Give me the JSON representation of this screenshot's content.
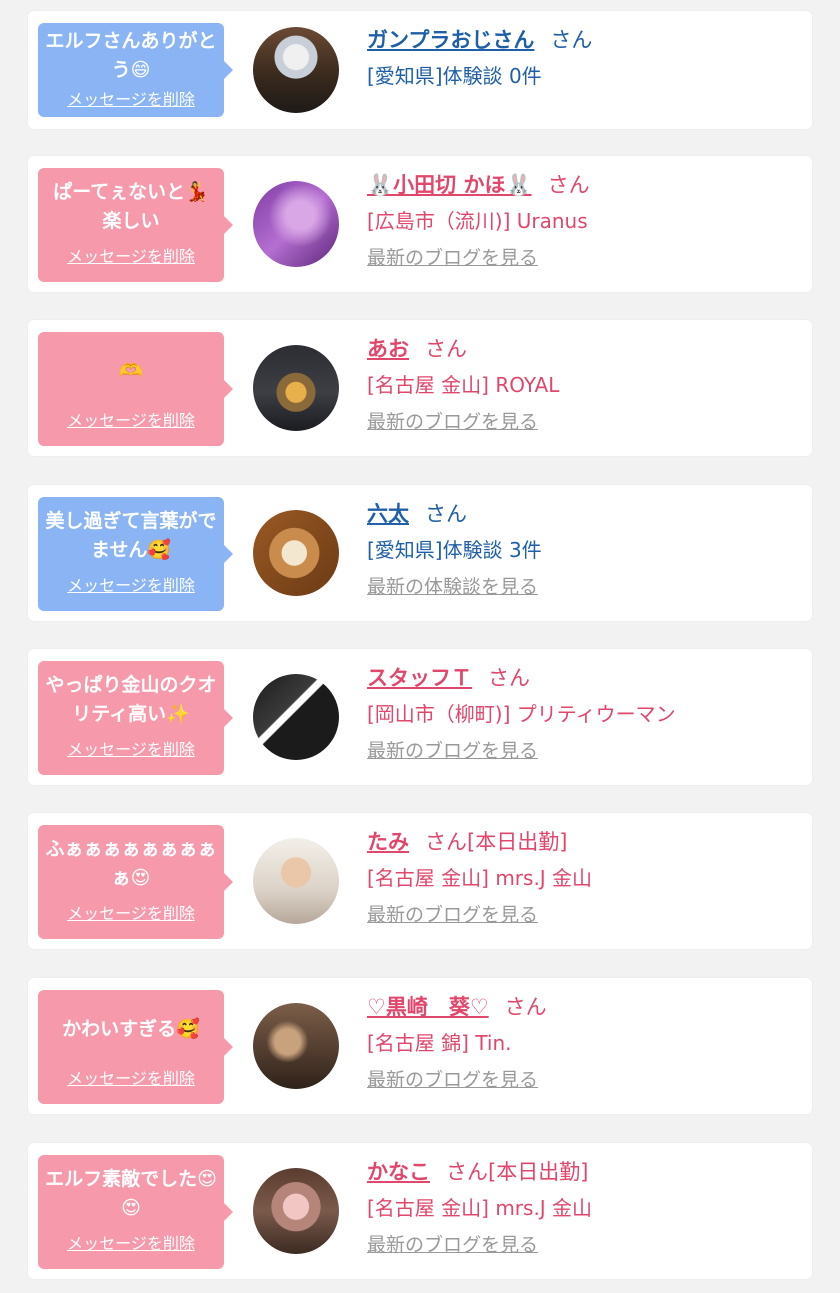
{
  "colors": {
    "blue_bubble": "#8ab4f3",
    "pink_bubble": "#f69aab",
    "blue_text": "#1f5fa8",
    "pink_text": "#e0476a",
    "gray_link": "#999999",
    "page_bg": "#f2f2f2"
  },
  "delete_label": "メッセージを削除",
  "items": [
    {
      "message": "エルフさんありがとう😄",
      "name": "ガンプラおじさん",
      "san": "さん",
      "location": "[愛知県]体験談 0件",
      "more": "",
      "avatar": "gundam-model-photo"
    },
    {
      "message": "ぱーてぇないと💃楽しい",
      "name": "🐰小田切 かほ🐰",
      "san": "さん",
      "location": "[広島市（流川)] Uranus",
      "more": "最新のブログを見る",
      "avatar": "purple-portrait-photo"
    },
    {
      "message": "🫶",
      "name": "あお",
      "san": "さん",
      "location": "[名古屋 金山] ROYAL",
      "more": "最新のブログを見る",
      "avatar": "night-building-photo"
    },
    {
      "message": "美し過ぎて言葉がでません🥰",
      "name": "六太",
      "san": "さん",
      "location": "[愛知県]体験談 3件",
      "more": "最新の体験談を見る",
      "avatar": "dessert-plate-photo"
    },
    {
      "message": "やっぱり金山のクオリティ高い✨",
      "name": "スタッフＴ",
      "san": "さん",
      "location": "[岡山市（柳町)] プリティウーマン",
      "more": "最新のブログを見る",
      "avatar": "pretty-woman-logo-photo"
    },
    {
      "message": "ふぁぁぁぁぁぁぁぁぁ😍",
      "name": "たみ",
      "san": "さん[本日出勤]",
      "location": "[名古屋 金山] mrs.J 金山",
      "more": "最新のブログを見る",
      "avatar": "woman-selfie-photo"
    },
    {
      "message": "かわいすぎる🥰",
      "name": "♡黒崎　葵♡",
      "san": "さん",
      "location": "[名古屋 錦] Tin.",
      "more": "最新のブログを見る",
      "avatar": "room-interior-photo"
    },
    {
      "message": "エルフ素敵でした😍😍",
      "name": "かなこ",
      "san": "さん[本日出勤]",
      "location": "[名古屋 金山] mrs.J 金山",
      "more": "最新のブログを見る",
      "avatar": "woman-portrait-photo"
    }
  ]
}
